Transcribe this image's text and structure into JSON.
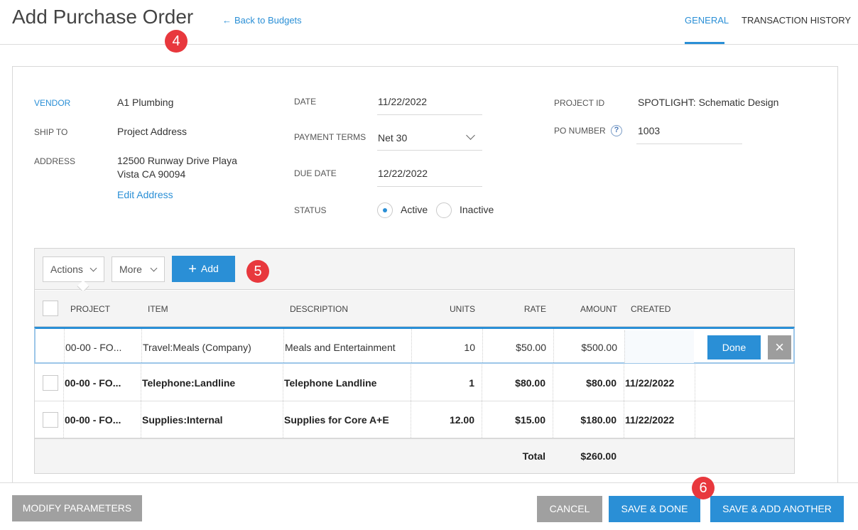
{
  "header": {
    "title": "Add Purchase Order",
    "back_link": "Back to Budgets",
    "tabs": [
      {
        "label": "GENERAL",
        "active": true
      },
      {
        "label": "TRANSACTION HISTORY",
        "active": false
      }
    ]
  },
  "badges": [
    "4",
    "5",
    "6"
  ],
  "vendor_section": {
    "vendor_label": "VENDOR",
    "vendor_value": "A1 Plumbing",
    "ship_to_label": "SHIP TO",
    "ship_to_value": "Project Address",
    "address_label": "ADDRESS",
    "address_line1": "12500 Runway Drive Playa",
    "address_line2": "Vista CA 90094",
    "edit_address": "Edit Address"
  },
  "date_section": {
    "date_label": "DATE",
    "date_value": "11/22/2022",
    "payment_terms_label": "PAYMENT TERMS",
    "payment_terms_value": "Net 30",
    "due_date_label": "DUE DATE",
    "due_date_value": "12/22/2022",
    "status_label": "STATUS",
    "status_options": [
      "Active",
      "Inactive"
    ],
    "status_selected": "Active"
  },
  "project_section": {
    "project_id_label": "PROJECT ID",
    "project_id_value": "SPOTLIGHT: Schematic Design",
    "po_number_label": "PO NUMBER",
    "po_number_help": "?",
    "po_number_value": "1003"
  },
  "grid": {
    "toolbar": {
      "actions_label": "Actions",
      "more_label": "More",
      "add_label": "Add"
    },
    "columns": [
      "PROJECT",
      "ITEM",
      "DESCRIPTION",
      "UNITS",
      "RATE",
      "AMOUNT",
      "CREATED"
    ],
    "rows": [
      {
        "project": "00-00 - FO...",
        "item": "Travel:Meals (Company)",
        "description": "Meals and Entertainment",
        "units": "10",
        "rate": "$50.00",
        "amount": "$500.00",
        "created": "",
        "editing": true
      },
      {
        "project": "00-00 - FO...",
        "item": "Telephone:Landline",
        "description": "Telephone Landline",
        "units": "1",
        "rate": "$80.00",
        "amount": "$80.00",
        "created": "11/22/2022",
        "editing": false
      },
      {
        "project": "00-00 - FO...",
        "item": "Supplies:Internal",
        "description": "Supplies for Core A+E",
        "units": "12.00",
        "rate": "$15.00",
        "amount": "$180.00",
        "created": "11/22/2022",
        "editing": false
      }
    ],
    "row_actions": {
      "done_label": "Done",
      "close_glyph": "×"
    },
    "total_label": "Total",
    "total_value": "$260.00"
  },
  "footer": {
    "modify_parameters": "MODIFY PARAMETERS",
    "cancel": "CANCEL",
    "save_done": "SAVE & DONE",
    "save_add_another": "SAVE & ADD ANOTHER"
  },
  "colors": {
    "accent": "#2a8fd6",
    "badge": "#e8383d",
    "muted_button": "#a0a0a0"
  }
}
